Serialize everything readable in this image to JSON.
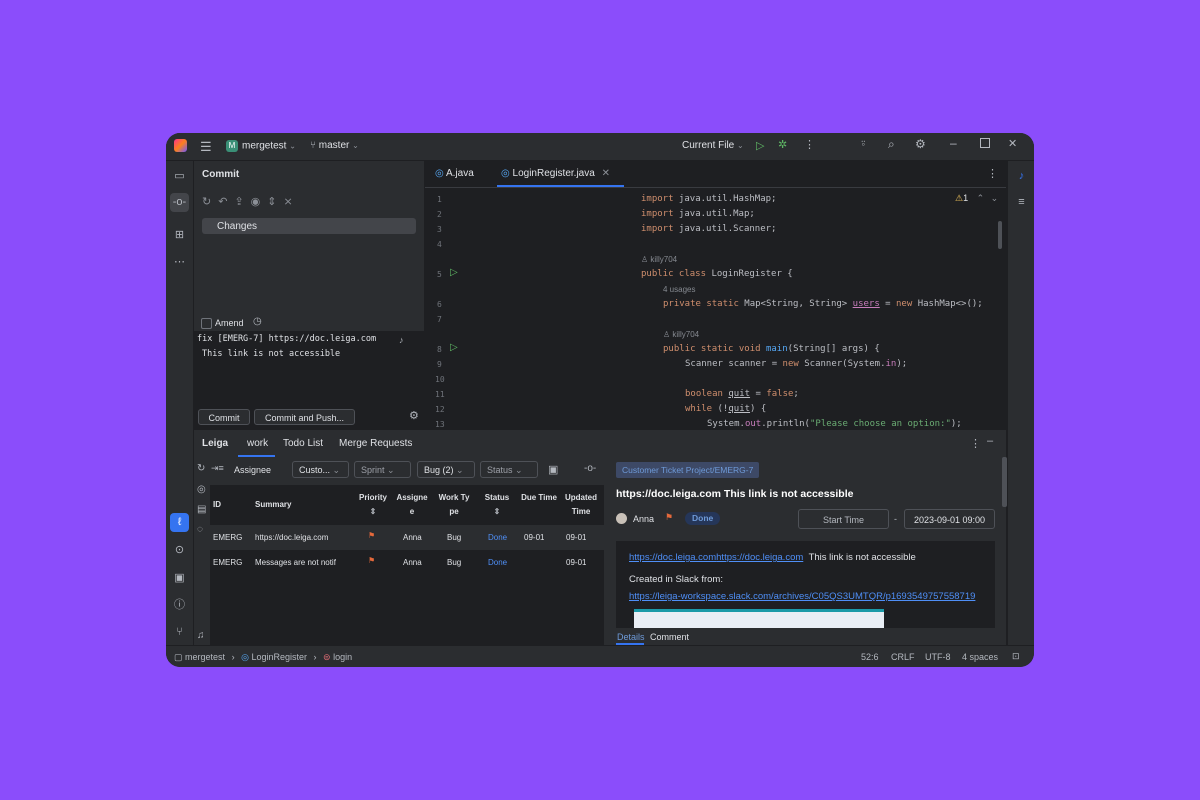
{
  "titlebar": {
    "project_badge": "M",
    "project": "mergetest",
    "branch": "master",
    "run_config": "Current File"
  },
  "commit": {
    "title": "Commit",
    "changes_label": "Changes",
    "amend_label": "Amend",
    "message_line1": "fix [EMERG-7] https://doc.leiga.com",
    "message_line2": "This link is not accessible",
    "commit_button": "Commit",
    "commit_push_button": "Commit and Push..."
  },
  "editor": {
    "tabs": [
      {
        "label": "A.java"
      },
      {
        "label": "LoginRegister.java"
      }
    ],
    "problems_count": "1",
    "author1": "killy704",
    "usages": "4 usages",
    "author2": "killy704",
    "line_numbers": [
      "1",
      "2",
      "3",
      "4",
      "5",
      "6",
      "7",
      "8",
      "9",
      "10",
      "11",
      "12",
      "13"
    ]
  },
  "bottom": {
    "tabs": [
      "Leiga",
      "work",
      "Todo List",
      "Merge Requests"
    ],
    "filters": {
      "assignee": "Assignee",
      "custom": "Custo...",
      "sprint": "Sprint",
      "bug": "Bug (2)",
      "status": "Status"
    },
    "columns": [
      "ID",
      "Summary",
      "Priority",
      "Assignee",
      "Work Type",
      "Status",
      "Due Time",
      "Updated Time"
    ],
    "rows": [
      {
        "id": "EMERG",
        "summary": "https://doc.leiga.com",
        "assignee": "Anna",
        "type": "Bug",
        "status": "Done",
        "due": "09-01",
        "updated": "09-01"
      },
      {
        "id": "EMERG",
        "summary": "Messages are not notif",
        "assignee": "Anna",
        "type": "Bug",
        "status": "Done",
        "due": "",
        "updated": "09-01"
      }
    ]
  },
  "detail": {
    "breadcrumb": "Customer Ticket Project/EMERG-7",
    "title": "https://doc.leiga.com This link is not accessible",
    "assignee": "Anna",
    "status": "Done",
    "start_time_label": "Start Time",
    "dash": "-",
    "end_time": "2023-09-01 09:00",
    "link1a": "https://doc.leiga.com",
    "link1b": "https://doc.leiga.com",
    "desc_text": "This link is not accessible",
    "created_label": "Created in Slack from:",
    "slack_link": "https://leiga-workspace.slack.com/archives/C05QS3UMTQR/p1693549757558719",
    "tabs": [
      "Details",
      "Comment"
    ]
  },
  "statusbar": {
    "crumbs": [
      "mergetest",
      "LoginRegister",
      "login"
    ],
    "position": "52:6",
    "line_sep": "CRLF",
    "encoding": "UTF-8",
    "indent": "4 spaces"
  },
  "colors": {
    "background": "#8b4dfb",
    "accent": "#3574f0",
    "done": "#4f8ff7",
    "flag": "#e5693b"
  }
}
